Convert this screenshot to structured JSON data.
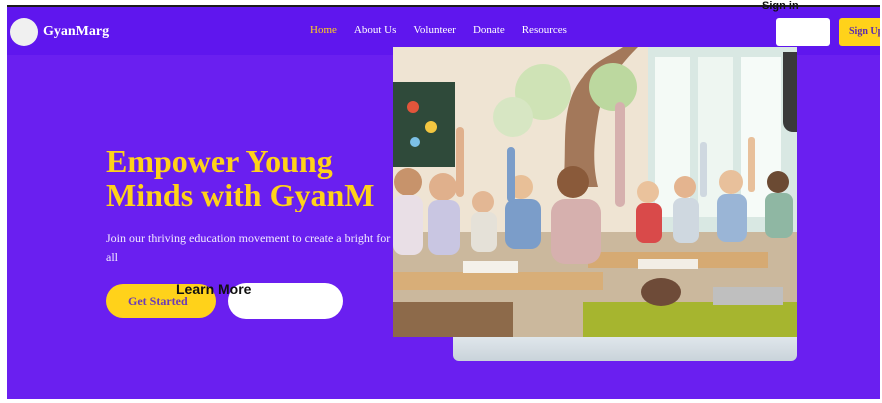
{
  "nav": {
    "brand": "GyanMarg",
    "items": [
      {
        "label": "Home",
        "active": true
      },
      {
        "label": "About Us",
        "active": false
      },
      {
        "label": "Volunteer",
        "active": false
      },
      {
        "label": "Donate",
        "active": false
      },
      {
        "label": "Resources",
        "active": false
      }
    ],
    "signin_label": "Sign in",
    "signup_label": "Sign Up"
  },
  "hero": {
    "title_line1": "Empower Young",
    "title_line2": "Minds with GyanM",
    "subtitle": "Join our thriving education movement to create a bright for all",
    "cta_primary": "Get Started",
    "cta_secondary": "Learn More"
  },
  "colors": {
    "background": "#6a1ff0",
    "nav_background": "#5f16ee",
    "accent": "#ffd21a",
    "active_link": "#ffd21a"
  },
  "icons": {
    "logo": "logo-circle-icon"
  }
}
